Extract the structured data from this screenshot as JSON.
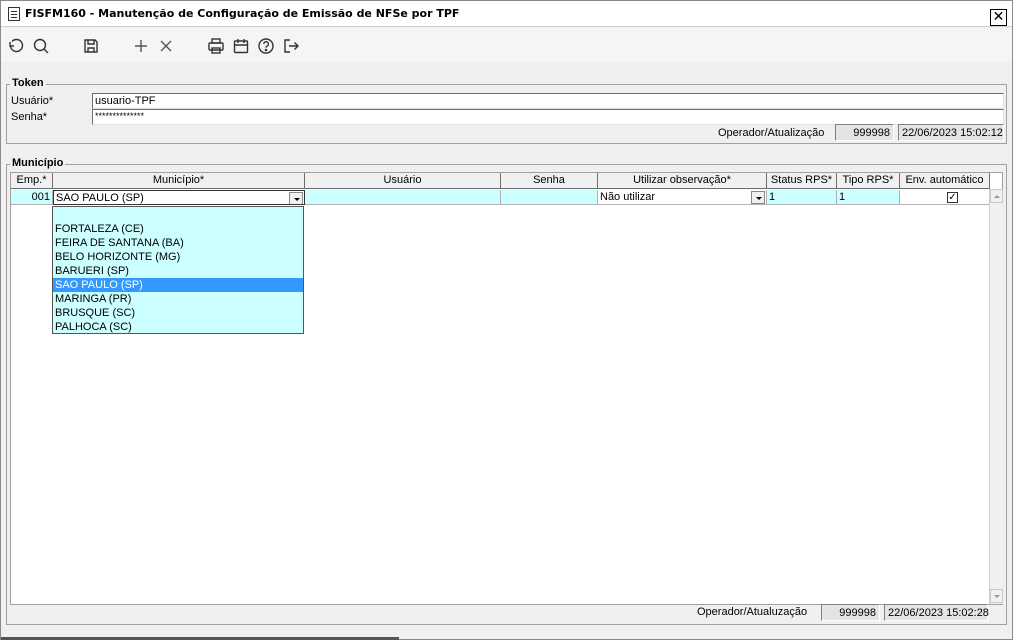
{
  "window": {
    "title": "FISFM160 - Manutenção de Configuração de Emissão de NFSe por TPF",
    "close_glyph": "✕"
  },
  "toolbar": {
    "buttons": [
      {
        "name": "undo-icon"
      },
      {
        "name": "search-icon"
      },
      {
        "name": "save-icon"
      },
      {
        "name": "add-icon"
      },
      {
        "name": "delete-icon"
      },
      {
        "name": "print-icon"
      },
      {
        "name": "calendar-icon"
      },
      {
        "name": "help-icon"
      },
      {
        "name": "exit-icon"
      }
    ]
  },
  "token": {
    "legend": "Token",
    "user_label": "Usuário*",
    "user_value": "usuario-TPF",
    "password_label": "Senha*",
    "password_value": "**************",
    "operator_label": "Operador/Atualização",
    "operator_value": "999998",
    "timestamp": "22/06/2023 15:02:12"
  },
  "municipio": {
    "legend": "Município",
    "columns": [
      "Emp.*",
      "Município*",
      "Usuário",
      "Senha",
      "Utilizar observação*",
      "Status RPS*",
      "Tipo RPS*",
      "Env. automático"
    ],
    "row": {
      "emp": "001",
      "municipio": "SAO PAULO (SP)",
      "usuario": "",
      "senha": "",
      "observacao": "Não utilizar",
      "status_rps": "1",
      "tipo_rps": "1",
      "env_automatico": "✓"
    },
    "dropdown_options": [
      "",
      "FORTALEZA (CE)",
      "FEIRA DE SANTANA (BA)",
      "BELO HORIZONTE (MG)",
      "BARUERI (SP)",
      "SAO PAULO (SP)",
      "MARINGA (PR)",
      "BRUSQUE (SC)",
      "PALHOCA (SC)"
    ],
    "dropdown_selected": "SAO PAULO (SP)",
    "operator_label": "Operador/Atualuzação",
    "operator_value": "999998",
    "timestamp": "22/06/2023 15:02:28"
  },
  "colors": {
    "grid_cell": "#ccffff",
    "selection": "#3399ff"
  }
}
